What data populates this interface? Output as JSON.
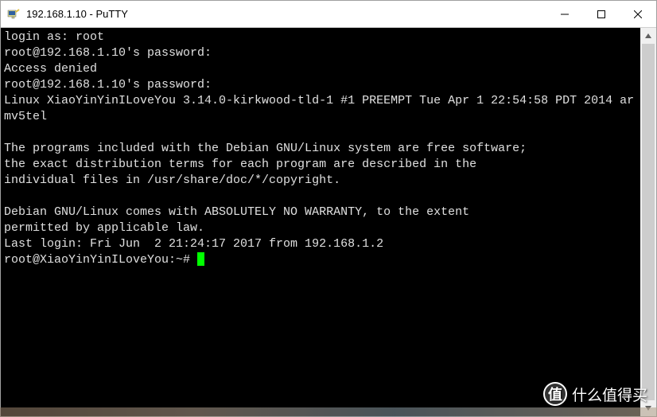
{
  "window": {
    "title": "192.168.1.10 - PuTTY"
  },
  "terminal": {
    "lines": [
      "login as: root",
      "root@192.168.1.10's password:",
      "Access denied",
      "root@192.168.1.10's password:",
      "Linux XiaoYinYinILoveYou 3.14.0-kirkwood-tld-1 #1 PREEMPT Tue Apr 1 22:54:58 PDT 2014 armv5tel",
      "",
      "The programs included with the Debian GNU/Linux system are free software;",
      "the exact distribution terms for each program are described in the",
      "individual files in /usr/share/doc/*/copyright.",
      "",
      "Debian GNU/Linux comes with ABSOLUTELY NO WARRANTY, to the extent",
      "permitted by applicable law.",
      "Last login: Fri Jun  2 21:24:17 2017 from 192.168.1.2"
    ],
    "prompt": "root@XiaoYinYinILoveYou:~# "
  },
  "watermark": {
    "symbol": "值",
    "text": "什么值得买"
  }
}
